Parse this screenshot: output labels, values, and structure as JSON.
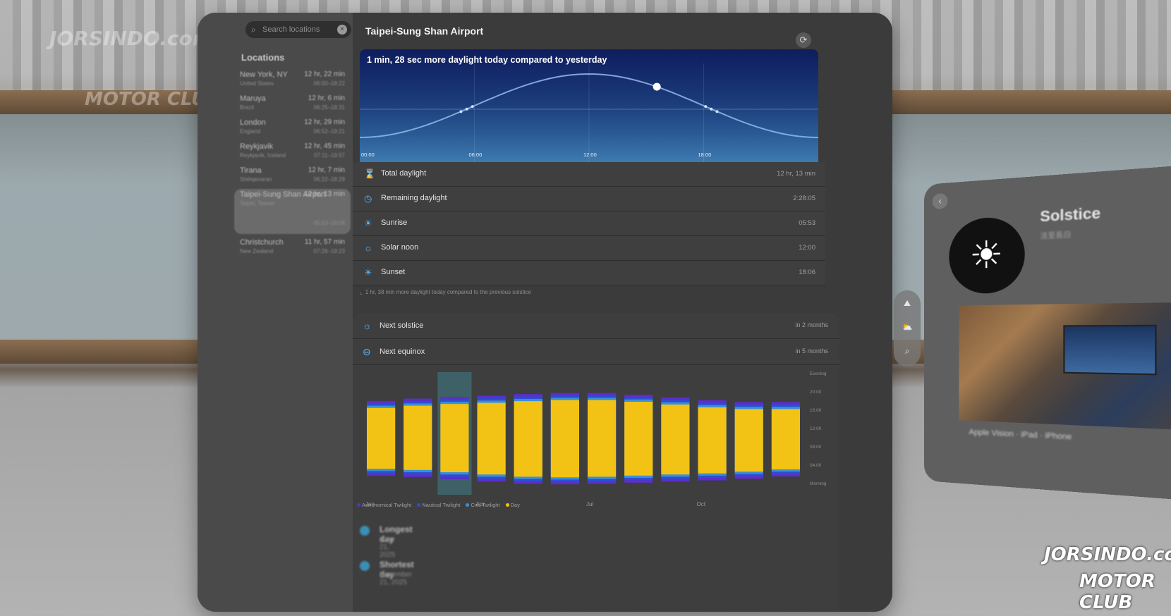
{
  "window": {
    "title": "Taipei-Sung Shan Airport",
    "search": {
      "placeholder": "Search locations"
    },
    "sidebar": {
      "heading": "Locations",
      "items": [
        {
          "name": "New York, NY",
          "sub": "United States",
          "daylight": "12 hr, 22 min",
          "time": "06:00–18:22"
        },
        {
          "name": "Maruya",
          "sub": "Brazil",
          "daylight": "12 hr, 6 min",
          "time": "06:25–18:31"
        },
        {
          "name": "London",
          "sub": "England",
          "daylight": "12 hr, 29 min",
          "time": "06:52–19:21"
        },
        {
          "name": "Reykjavik",
          "sub": "Reykjavík, Iceland",
          "daylight": "12 hr, 45 min",
          "time": "07:11–19:57"
        },
        {
          "name": "Tirana",
          "sub": "Shëtqevaran",
          "daylight": "12 hr, 7 min",
          "time": "06:22–18:29"
        },
        {
          "name": "Taipei-Sung Shan Airport",
          "sub": "Taipei, Taiwan",
          "daylight": "12 hr, 13 min",
          "time": "05:53–18:06"
        },
        {
          "name": "Christchurch",
          "sub": "New Zealand",
          "daylight": "11 hr, 57 min",
          "time": "07:26–19:23"
        }
      ]
    },
    "chart_headline": "1 min, 28 sec more daylight today compared to yesterday",
    "stats": [
      {
        "icon": "hourglass-icon",
        "glyph": "⌛",
        "label": "Total daylight",
        "value": "12 hr, 13 min"
      },
      {
        "icon": "timer-icon",
        "glyph": "◷",
        "label": "Remaining daylight",
        "value": "2:28:05"
      },
      {
        "icon": "sunrise-icon",
        "glyph": "☀",
        "label": "Sunrise",
        "value": "05:53"
      },
      {
        "icon": "sun-icon",
        "glyph": "☼",
        "label": "Solar noon",
        "value": "12:00"
      },
      {
        "icon": "sunset-icon",
        "glyph": "☀",
        "label": "Sunset",
        "value": "18:06"
      }
    ],
    "footnote": "1 hr, 38 min more daylight today compared to the previous solstice",
    "events": [
      {
        "icon": "sun-icon",
        "glyph": "☼",
        "label": "Next solstice",
        "value": "in 2 months"
      },
      {
        "icon": "globe-icon",
        "glyph": "⊖",
        "label": "Next equinox",
        "value": "in 5 months"
      }
    ],
    "legend": [
      "Astronomical Twilight",
      "Nautical Twilight",
      "Civil Twilight",
      "Day"
    ],
    "longest": {
      "label": "Longest day",
      "date": "June 21, 2025"
    },
    "shortest": {
      "label": "Shortest day",
      "date": "December 21, 2025"
    }
  },
  "colors": {
    "accent": "#5ab6ff",
    "day": "#f2c314",
    "civil": "#3b8fd6",
    "nautical": "#2b4fcf",
    "astro": "#5a2fcc"
  },
  "chart_data": [
    {
      "type": "line",
      "title": "1 min, 28 sec more daylight today compared to yesterday",
      "x": [
        "00:00",
        "06:00",
        "12:00",
        "18:00"
      ],
      "xlim": [
        0,
        24
      ],
      "series": [
        {
          "values_x": [
            0,
            3,
            6,
            9,
            12,
            15,
            18,
            21,
            24
          ],
          "values_y": [
            -0.8,
            -0.6,
            0.02,
            0.72,
            1,
            0.72,
            0.02,
            -0.6,
            -0.8
          ]
        }
      ],
      "current_time": 15.55
    },
    {
      "type": "bar",
      "categories": [
        "Jan",
        "Feb",
        "Mar",
        "Apr",
        "May",
        "Jun",
        "Jul",
        "Aug",
        "Sep",
        "Oct",
        "Nov",
        "Dec"
      ],
      "x_ticks": [
        "Jan",
        "Apr",
        "Jul",
        "Oct"
      ],
      "y_ticks": [
        "Evening",
        "20:00",
        "16:00",
        "12:00",
        "08:00",
        "04:00",
        "Morning"
      ],
      "sunrise": [
        6.6,
        6.4,
        6.0,
        5.6,
        5.2,
        5.1,
        5.2,
        5.4,
        5.6,
        5.8,
        6.1,
        6.5
      ],
      "sunset": [
        17.4,
        17.8,
        18.1,
        18.3,
        18.6,
        18.8,
        18.8,
        18.5,
        18.0,
        17.5,
        17.2,
        17.2
      ],
      "highlight_month": "Mar"
    }
  ],
  "right_window": {
    "title": "Solstice",
    "subtitle": "法至長日",
    "meta": "Apple Vision · iPad · iPhone"
  },
  "watermark": {
    "line1": "JORSINDO.com",
    "line2": "MOTOR CLUB"
  }
}
